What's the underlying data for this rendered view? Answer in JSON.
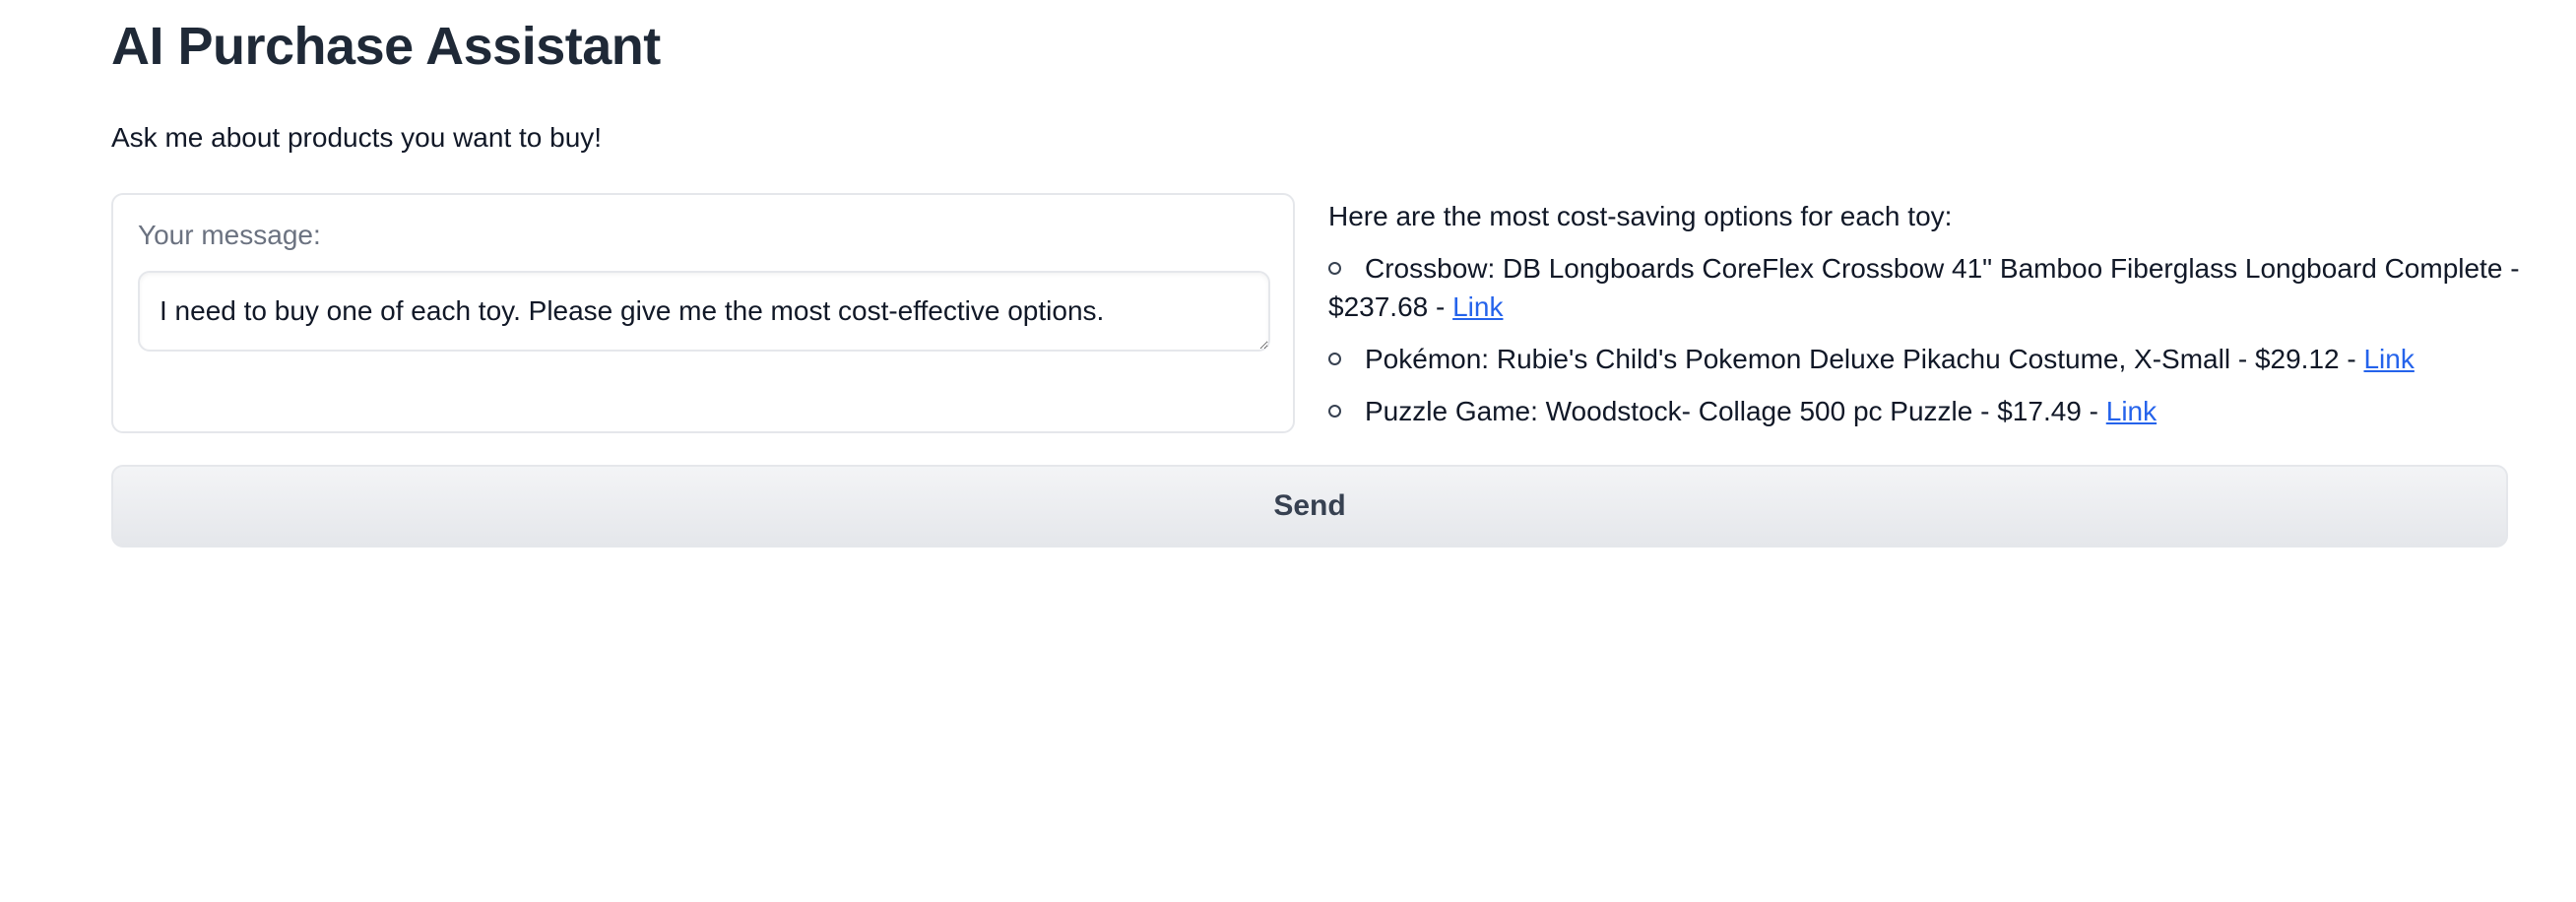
{
  "header": {
    "title": "AI Purchase Assistant",
    "subtitle": "Ask me about products you want to buy!"
  },
  "input": {
    "label": "Your message:",
    "value": "I need to buy one of each toy. Please give me the most cost-effective options."
  },
  "response": {
    "intro": "Here are the most cost-saving options for each toy:",
    "options": [
      {
        "text": "Crossbow: DB Longboards CoreFlex Crossbow 41\" Bamboo Fiberglass Longboard Complete - $237.68 - ",
        "link_label": "Link"
      },
      {
        "text": "Pokémon: Rubie's Child's Pokemon Deluxe Pikachu Costume, X-Small - $29.12 - ",
        "link_label": "Link"
      },
      {
        "text": "Puzzle Game: Woodstock- Collage 500 pc Puzzle - $17.49 - ",
        "link_label": "Link"
      }
    ]
  },
  "actions": {
    "send_label": "Send"
  },
  "colors": {
    "link": "#2563eb",
    "text": "#1f2937",
    "border": "#e5e7eb",
    "button_bg": "#e5e7eb"
  }
}
